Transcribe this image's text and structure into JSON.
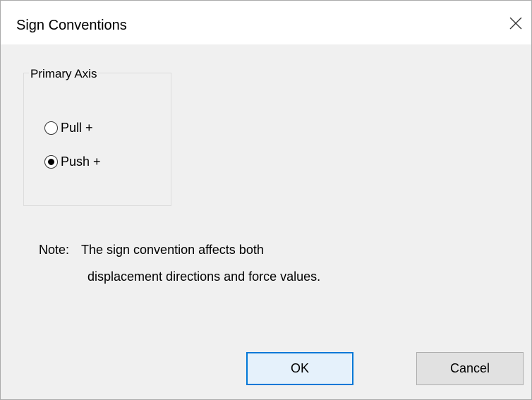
{
  "window": {
    "title": "Sign Conventions"
  },
  "group": {
    "label": "Primary Axis",
    "options": [
      {
        "label": "Pull +",
        "checked": false
      },
      {
        "label": "Push +",
        "checked": true
      }
    ]
  },
  "note": {
    "prefix": "Note:",
    "line1": "The sign convention affects both",
    "line2": "displacement directions and force values."
  },
  "buttons": {
    "ok": "OK",
    "cancel": "Cancel"
  },
  "colors": {
    "accent": "#0078d7",
    "background": "#f0f0f0"
  }
}
